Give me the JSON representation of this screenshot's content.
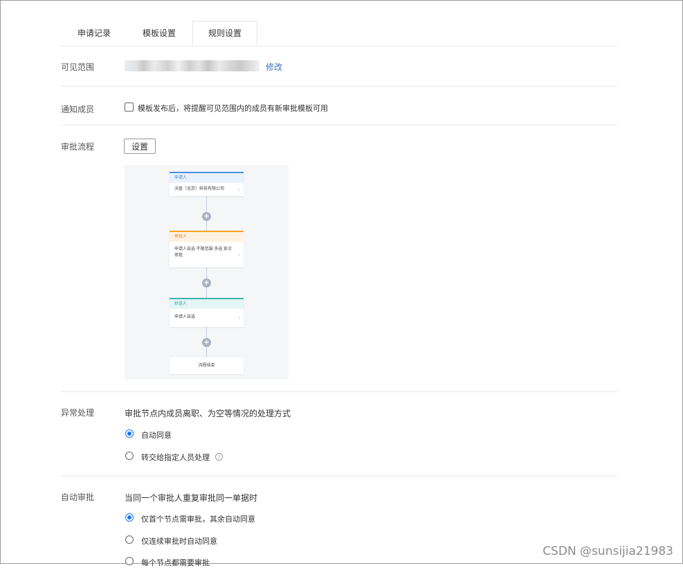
{
  "tabs": [
    {
      "label": "申请记录"
    },
    {
      "label": "模板设置"
    },
    {
      "label": "规则设置",
      "active": true
    }
  ],
  "scope": {
    "label": "可见范围",
    "modify_label": "修改"
  },
  "notify": {
    "label": "通知成员",
    "checkbox_text": "模板发布后，将提醒可见范围内的成员有新审批模板可用",
    "checked": false
  },
  "flow": {
    "label": "审批流程",
    "set_button": "设置",
    "nodes": {
      "applicant": {
        "title": "申请人",
        "body": "沃盈（北京）科技有限公司"
      },
      "approver": {
        "title": "审批人",
        "body": "申请人自选 不限范围 多选 依次审批"
      },
      "cc": {
        "title": "抄送人",
        "body": "申请人自选"
      },
      "end": {
        "body": "流程结束"
      }
    },
    "plus_symbol": "+"
  },
  "exception": {
    "label": "异常处理",
    "description": "审批节点内成员离职、为空等情况的处理方式",
    "options": [
      {
        "label": "自动同意",
        "checked": true
      },
      {
        "label": "转交给指定人员处理",
        "checked": false
      }
    ]
  },
  "auto_approval": {
    "label": "自动审批",
    "description": "当同一个审批人重复审批同一单据时",
    "options": [
      {
        "label": "仅首个节点需审批，其余自动同意",
        "checked": true
      },
      {
        "label": "仅连续审批时自动同意",
        "checked": false
      },
      {
        "label": "每个节点都需要审批",
        "checked": false
      }
    ]
  },
  "watermark": "CSDN @sunsijia21983",
  "colors": {
    "accent": "#1677ff",
    "link": "#3a6fc4"
  }
}
